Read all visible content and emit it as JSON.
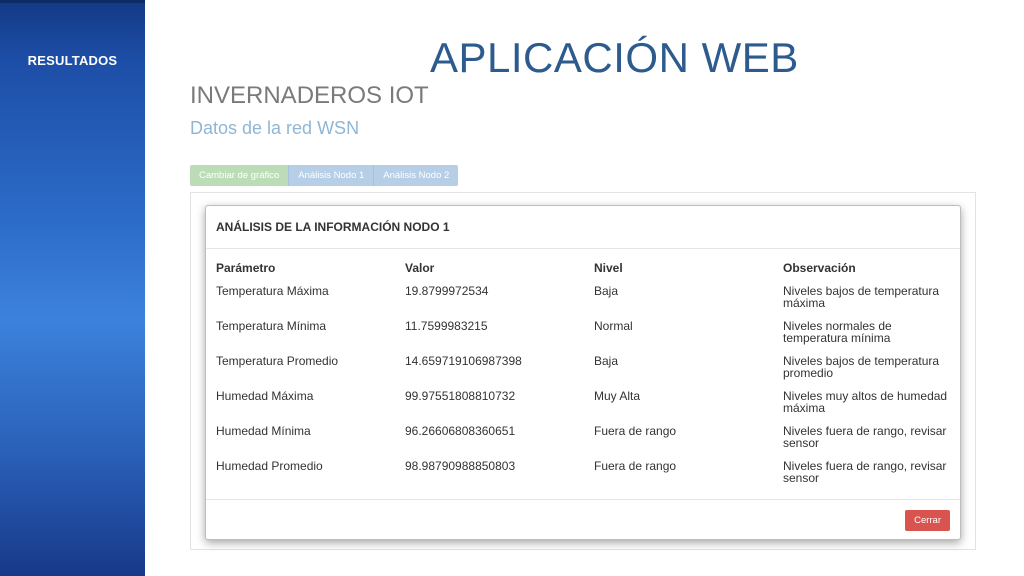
{
  "sidebar": {
    "label": "RESULTADOS"
  },
  "slide": {
    "title": "APLICACIÓN WEB"
  },
  "app": {
    "title": "INVERNADEROS IOT",
    "subtitle": "Datos de la red WSN",
    "buttons": [
      {
        "label": "Cambiar de gráfico",
        "color": "#bcdcb8"
      },
      {
        "label": "Análisis Nodo 1",
        "color": "#b6cfe7"
      },
      {
        "label": "Análisis Nodo 2",
        "color": "#b6cfe7"
      }
    ]
  },
  "modal": {
    "title": "ANÁLISIS DE LA INFORMACIÓN NODO 1",
    "columns": [
      "Parámetro",
      "Valor",
      "Nivel",
      "Observación"
    ],
    "rows": [
      [
        "Temperatura Máxima",
        "19.8799972534",
        "Baja",
        "Niveles bajos de temperatura máxima"
      ],
      [
        "Temperatura Mínima",
        "11.7599983215",
        "Normal",
        "Niveles normales de temperatura mínima"
      ],
      [
        "Temperatura Promedio",
        "14.659719106987398",
        "Baja",
        "Niveles bajos de temperatura promedio"
      ],
      [
        "Humedad Máxima",
        "99.97551808810732",
        "Muy Alta",
        "Niveles muy altos de humedad máxima"
      ],
      [
        "Humedad Mínima",
        "96.26606808360651",
        "Fuera de rango",
        "Niveles fuera de rango, revisar sensor"
      ],
      [
        "Humedad Promedio",
        "98.98790988850803",
        "Fuera de rango",
        "Niveles fuera de rango, revisar sensor"
      ]
    ],
    "close_label": "Cerrar",
    "close_color": "#d9534f"
  }
}
